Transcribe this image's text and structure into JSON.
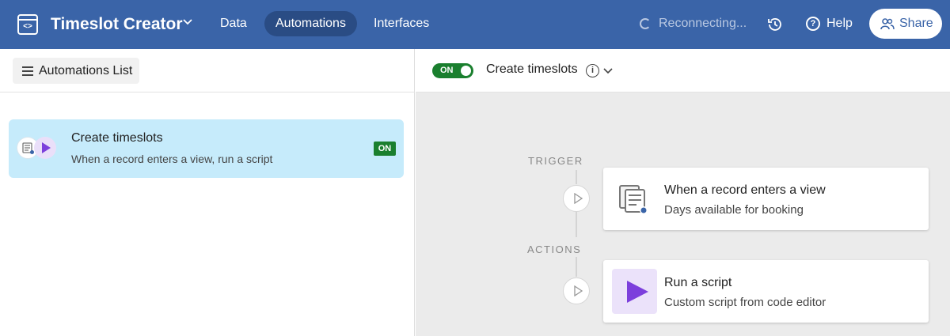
{
  "topbar": {
    "app_title": "Timeslot Creator",
    "nav": [
      "Data",
      "Automations",
      "Interfaces"
    ],
    "status": "Reconnecting...",
    "help_label": "Help",
    "share_label": "Share",
    "accent_color": "#3a64a8",
    "active_nav": "Automations"
  },
  "left": {
    "list_button": "Automations List",
    "items": [
      {
        "title": "Create timeslots",
        "subtitle": "When a record enters a view, run a script",
        "status": "ON"
      }
    ]
  },
  "right": {
    "toggle_label": "ON",
    "automation_name": "Create timeslots",
    "trigger_label": "TRIGGER",
    "actions_label": "ACTIONS",
    "trigger": {
      "title": "When a record enters a view",
      "subtitle": "Days available for booking",
      "icon": "record-view-icon"
    },
    "action": {
      "title": "Run a script",
      "subtitle": "Custom script from code editor",
      "icon": "play-script-icon"
    }
  }
}
